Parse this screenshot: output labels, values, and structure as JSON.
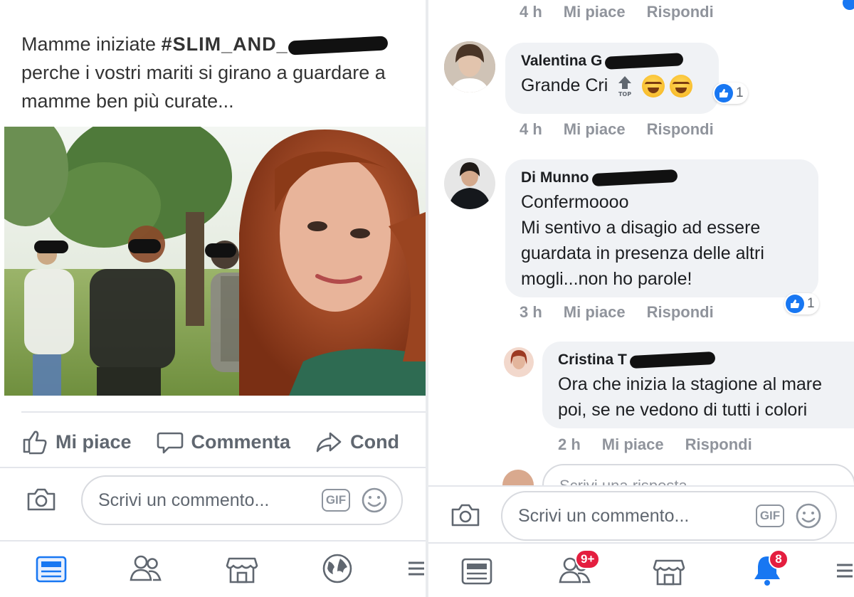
{
  "post": {
    "line1_prefix": "Mamme iniziate",
    "hashtag": "#SLIM_AND_",
    "line2": "perche i vostri mariti si girano a guardare a",
    "line3": "mamme ben più  curate..."
  },
  "post_actions": {
    "like": "Mi piace",
    "comment": "Commenta",
    "share": "Cond"
  },
  "left_comment_box": {
    "placeholder": "Scrivi un commento...",
    "gif": "GIF"
  },
  "right_comment_box": {
    "placeholder": "Scrivi un commento...",
    "gif": "GIF"
  },
  "colors": {
    "facebook_blue": "#1877f2",
    "badge_red": "#e41e3f",
    "bubble_bg": "#f0f2f5",
    "meta_grey": "#90949c"
  },
  "comments": [
    {
      "meta": {
        "time": "4 h",
        "like": "Mi piace",
        "reply": "Rispondi"
      }
    },
    {
      "name": "Valentina G",
      "text": "Grande Cri",
      "reaction_count": "1",
      "meta": {
        "time": "4 h",
        "like": "Mi piace",
        "reply": "Rispondi"
      }
    },
    {
      "name": "Di Munno",
      "lines": [
        "Confermoooo",
        "Mi sentivo a disagio ad essere",
        "guardata in presenza delle altri",
        "mogli...non ho parole!"
      ],
      "reaction_count": "1",
      "meta": {
        "time": "3 h",
        "like": "Mi piace",
        "reply": "Rispondi"
      }
    },
    {
      "name": "Cristina T",
      "lines": [
        "Ora che inizia la stagione al mare",
        "poi, se ne vedono di tutti i colori"
      ],
      "meta": {
        "time": "2 h",
        "like": "Mi piace",
        "reply": "Rispondi"
      }
    }
  ],
  "reply_box": {
    "placeholder_partial": "Scrivi una risposta..."
  },
  "nav": {
    "friends_badge": "9+",
    "notifications_badge": "8"
  }
}
